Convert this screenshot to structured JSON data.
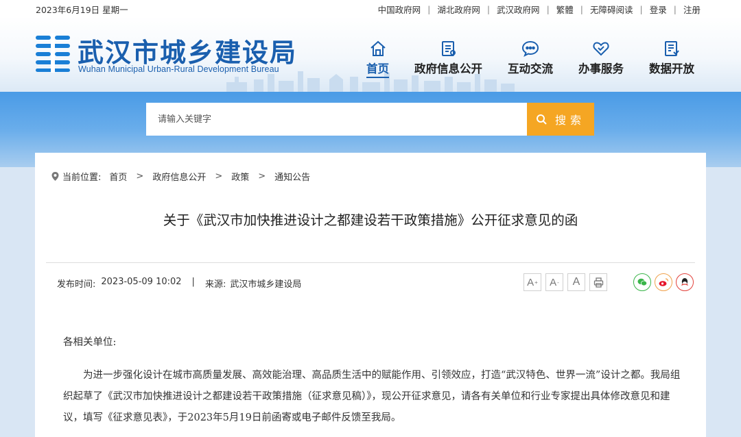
{
  "topbar": {
    "date": "2023年6月19日 星期一",
    "links": [
      "中国政府网",
      "湖北政府网",
      "武汉政府网",
      "繁體",
      "无障碍阅读",
      "登录",
      "注册"
    ]
  },
  "header": {
    "site_name_cn": "武汉市城乡建设局",
    "site_name_en": "Wuhan Municipal Urban-Rural Development Bureau",
    "nav": [
      {
        "label": "首页",
        "icon": "home-icon",
        "active": true
      },
      {
        "label": "政府信息公开",
        "icon": "document-icon"
      },
      {
        "label": "互动交流",
        "icon": "chat-icon"
      },
      {
        "label": "办事服务",
        "icon": "heart-service-icon"
      },
      {
        "label": "数据开放",
        "icon": "data-icon"
      }
    ]
  },
  "search": {
    "placeholder": "请输入关键字",
    "button_label": "搜索"
  },
  "breadcrumb": {
    "prefix": "当前位置:",
    "items": [
      "首页",
      "政府信息公开",
      "政策",
      "通知公告"
    ]
  },
  "article": {
    "title": "关于《武汉市加快推进设计之都建设若干政策措施》公开征求意见的函",
    "publish_label": "发布时间:",
    "publish_time": "2023-05-09 10:02",
    "source_label": "来源:",
    "source": "武汉市城乡建设局",
    "salutation": "各相关单位:",
    "paragraph": "为进一步强化设计在城市高质量发展、高效能治理、高品质生活中的赋能作用、引领效应，打造“武汉特色、世界一流”设计之都。我局组织起草了《武汉市加快推进设计之都建设若干政策措施（征求意见稿）》，现公开征求意见，请各有关单位和行业专家提出具体修改意见和建议，填写《征求意见表》，于2023年5月19日前函寄或电子邮件反馈至我局。"
  },
  "tools": {
    "font_buttons": [
      "A",
      "A",
      "A"
    ],
    "share": [
      "wechat-icon",
      "weibo-icon",
      "qq-icon"
    ]
  },
  "colors": {
    "brand": "#1a5fae",
    "search_button": "#f5a623",
    "band": "#4a9be6"
  }
}
